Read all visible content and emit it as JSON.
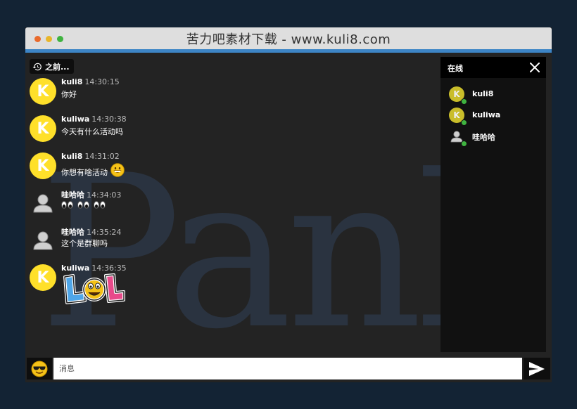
{
  "window": {
    "title": "苦力吧素材下载 - www.kuli8.com"
  },
  "history": {
    "label": "之前..."
  },
  "watermark": {
    "text": "Panl"
  },
  "messages": [
    {
      "name": "kuli8",
      "time": "14:30:15",
      "text": "你好",
      "avatar": "K"
    },
    {
      "name": "kuliwa",
      "time": "14:30:38",
      "text": "今天有什么活动吗",
      "avatar": "K"
    },
    {
      "name": "kuli8",
      "time": "14:31:02",
      "text": "你想有啥活动",
      "avatar": "K",
      "emoji": "grin-emoji"
    },
    {
      "name": "哇哈哈",
      "time": "14:34:03",
      "text": "",
      "avatar": "user-icon",
      "emoji": "eyes-emoji"
    },
    {
      "name": "哇哈哈",
      "time": "14:35:24",
      "text": "这个是群聊吗",
      "avatar": "user-icon"
    },
    {
      "name": "kuliwa",
      "time": "14:36:35",
      "text": "",
      "avatar": "K",
      "sticker": "lol-sticker"
    }
  ],
  "online_panel": {
    "title": "在线",
    "users": [
      {
        "name": "kuli8",
        "avatar": "K"
      },
      {
        "name": "kuliwa",
        "avatar": "K"
      },
      {
        "name": "哇哈哈",
        "avatar": "user-icon"
      }
    ]
  },
  "composer": {
    "placeholder": "消息"
  },
  "colors": {
    "background": "#132334",
    "accent": "#3d85c6",
    "avatar_yellow": "#ffe02a",
    "online": "#3fb340"
  }
}
